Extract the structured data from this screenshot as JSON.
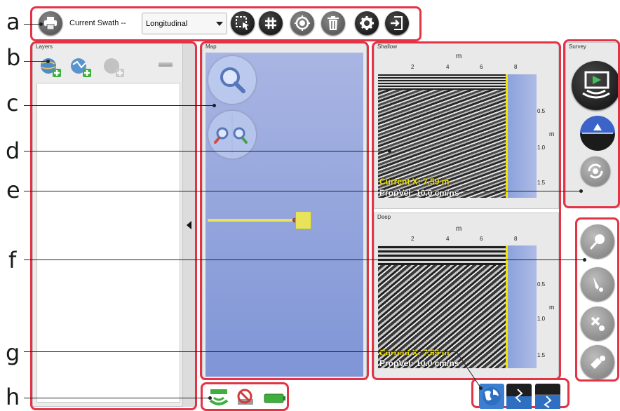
{
  "toolbar": {
    "swath_label": "Current Swath --",
    "swath_value": "Longitudinal"
  },
  "panels": {
    "layers_title": "Layers",
    "map_title": "Map",
    "shallow_title": "Shallow",
    "deep_title": "Deep",
    "survey_title": "Survey"
  },
  "shallow": {
    "x_unit": "m",
    "x_ticks": [
      "2",
      "4",
      "6",
      "8"
    ],
    "y_unit": "m",
    "y_ticks": [
      "0.5",
      "1.0",
      "1.5"
    ],
    "current_x": "Current X: 7.59 m",
    "prop_vel": "PropVel: 10.0 cm/ns"
  },
  "deep": {
    "x_unit": "m",
    "x_ticks": [
      "2",
      "4",
      "6",
      "8"
    ],
    "y_unit": "m",
    "y_ticks": [
      "0.5",
      "1.0",
      "1.5"
    ],
    "current_x": "Current X: 7.59 m",
    "prop_vel": "PropVel: 10.0 cm/ns"
  },
  "callouts": [
    "a",
    "b",
    "c",
    "d",
    "e",
    "f",
    "g",
    "h"
  ],
  "colors": {
    "highlight": "#e53346",
    "map_blue": "#8a9edb",
    "cursor_yellow": "#f5e400"
  }
}
